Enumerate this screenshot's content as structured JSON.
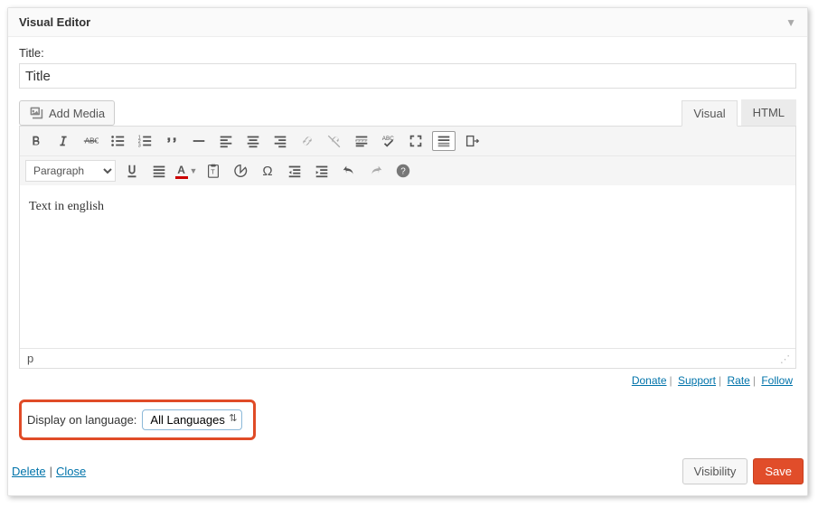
{
  "panel": {
    "title": "Visual Editor"
  },
  "titleField": {
    "label": "Title:",
    "value": "Title"
  },
  "addMedia": {
    "label": "Add Media"
  },
  "tabs": {
    "visual": "Visual",
    "html": "HTML"
  },
  "paragraphSelect": {
    "selected": "Paragraph"
  },
  "editor": {
    "content": "Text in english"
  },
  "statusBar": {
    "path": "p"
  },
  "footerLinks": {
    "donate": "Donate",
    "support": "Support",
    "rate": "Rate",
    "follow": "Follow"
  },
  "languageRow": {
    "label": "Display on language:",
    "selected": "All Languages",
    "options": [
      "All Languages"
    ]
  },
  "deleteClose": {
    "delete": "Delete",
    "close": "Close"
  },
  "actions": {
    "visibility": "Visibility",
    "save": "Save"
  }
}
